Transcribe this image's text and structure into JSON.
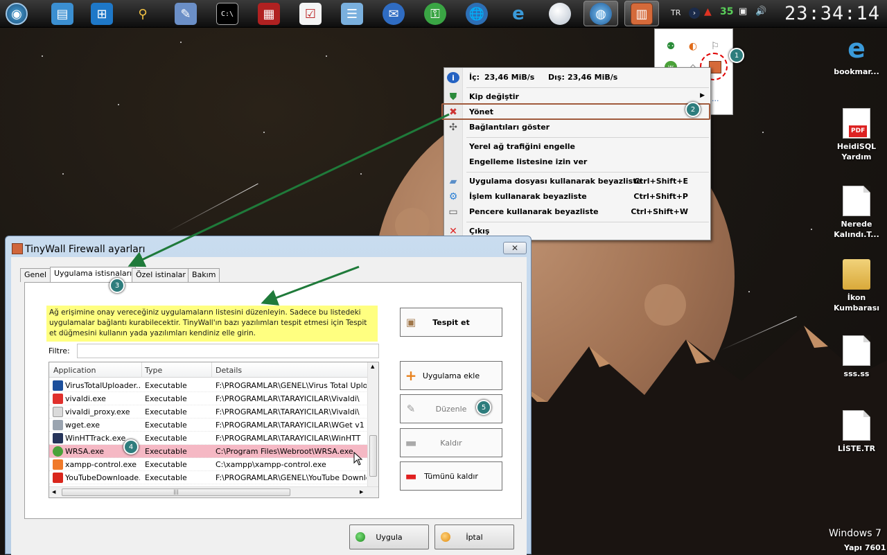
{
  "taskbar": {
    "lang": "TR",
    "tray_badge": "35",
    "clock": "23:34:14"
  },
  "context_menu": {
    "stats_in_label": "İç:",
    "stats_in_value": "23,46 MiB/s",
    "stats_out_label": "Dış:",
    "stats_out_value": "23,46 MiB/s",
    "items": [
      {
        "label": "Kip değiştir",
        "shortcut": "",
        "icon": "shield-icon"
      },
      {
        "label": "Yönet",
        "shortcut": "",
        "icon": "tools-icon"
      },
      {
        "label": "Bağlantıları göster",
        "shortcut": "",
        "icon": "network-icon"
      },
      {
        "label": "Yerel ağ trafiğini engelle",
        "shortcut": "",
        "icon": ""
      },
      {
        "label": "Engelleme listesine izin ver",
        "shortcut": "",
        "icon": ""
      },
      {
        "label": "Uygulama dosyası kullanarak beyazliste",
        "shortcut": "Ctrl+Shift+E",
        "icon": "file-icon"
      },
      {
        "label": "İşlem kullanarak beyazliste",
        "shortcut": "Ctrl+Shift+P",
        "icon": "gear-icon"
      },
      {
        "label": "Pencere kullanarak beyazliste",
        "shortcut": "Ctrl+Shift+W",
        "icon": "window-icon"
      },
      {
        "label": "Çıkış",
        "shortcut": "",
        "icon": "exit-icon"
      }
    ]
  },
  "markers": [
    "1",
    "2",
    "3",
    "4",
    "5"
  ],
  "dialog": {
    "title": "TinyWall Firewall ayarları",
    "tabs": [
      "Genel",
      "Uygulama istisnaları",
      "Özel istinalar",
      "Bakım"
    ],
    "active_tab": 1,
    "hint": "Ağ erişimine onay vereceğiniz uygulamaların listesini düzenleyin. Sadece bu listedeki uygulamalar bağlantı kurabilecektir. TinyWall'ın bazı yazılımları tespit etmesi için Tespit et düğmesini kullanın yada yazılımları kendiniz elle girin.",
    "filter_label": "Filtre:",
    "filter_value": "",
    "columns": [
      "Application",
      "Type",
      "Details"
    ],
    "rows": [
      {
        "app": "VirusTotalUploader...",
        "type": "Executable",
        "details": "F:\\PROGRAMLAR\\GENEL\\Virus Total Uplo",
        "color": "#1c4f9c",
        "selected": false
      },
      {
        "app": "vivaldi.exe",
        "type": "Executable",
        "details": "F:\\PROGRAMLAR\\TARAYICILAR\\Vivaldi\\",
        "color": "#e0302c",
        "selected": false
      },
      {
        "app": "vivaldi_proxy.exe",
        "type": "Executable",
        "details": "F:\\PROGRAMLAR\\TARAYICILAR\\Vivaldi\\",
        "color": "#dadada",
        "selected": false
      },
      {
        "app": "wget.exe",
        "type": "Executable",
        "details": "F:\\PROGRAMLAR\\TARAYICILAR\\WGet v1",
        "color": "#9aa4b0",
        "selected": false
      },
      {
        "app": "WinHTTrack.exe",
        "type": "Executable",
        "details": "F:\\PROGRAMLAR\\TARAYICILAR\\WinHTT",
        "color": "#26345a",
        "selected": false
      },
      {
        "app": "WRSA.exe",
        "type": "Executable",
        "details": "C:\\Program Files\\Webroot\\WRSA.exe",
        "color": "#4ba23a",
        "selected": true
      },
      {
        "app": "xampp-control.exe",
        "type": "Executable",
        "details": "C:\\xampp\\xampp-control.exe",
        "color": "#f07a2a",
        "selected": false
      },
      {
        "app": "YouTubeDownloade...",
        "type": "Executable",
        "details": "F:\\PROGRAMLAR\\GENEL\\YouTube Downlo",
        "color": "#d9261c",
        "selected": false
      }
    ],
    "side_buttons": [
      {
        "label": "Tespit et",
        "icon": "box-icon",
        "disabled": false
      },
      {
        "label": "Uygulama ekle",
        "icon": "plus-icon",
        "disabled": false
      },
      {
        "label": "Düzenle",
        "icon": "pencil-icon",
        "disabled": true
      },
      {
        "label": "Kaldır",
        "icon": "minus-icon",
        "disabled": true
      },
      {
        "label": "Tümünü kaldır",
        "icon": "minus-icon",
        "disabled": false
      }
    ],
    "ok_label": "Uygula",
    "cancel_label": "İptal"
  },
  "desktop_icons": [
    {
      "label": "bookmar...",
      "icon": "ie-icon"
    },
    {
      "label": "HeidiSQL Yardım",
      "icon": "pdf-icon"
    },
    {
      "label": "Nerede Kalındı.T...",
      "icon": "document-icon"
    },
    {
      "label": "İkon Kumbarası",
      "icon": "folder-icon"
    },
    {
      "label": "sss.ss",
      "icon": "document-icon"
    },
    {
      "label": "LİSTE.TR",
      "icon": "document-icon"
    }
  ],
  "os": {
    "name": "Windows 7",
    "build": "Yapı 7601"
  },
  "colors": {
    "highlight_border": "#a05a3c",
    "selected_row": "#f5b8c4",
    "hint_bg": "#ffff80",
    "marker": "#2e7d7d",
    "arrow": "#1f7a3a"
  }
}
